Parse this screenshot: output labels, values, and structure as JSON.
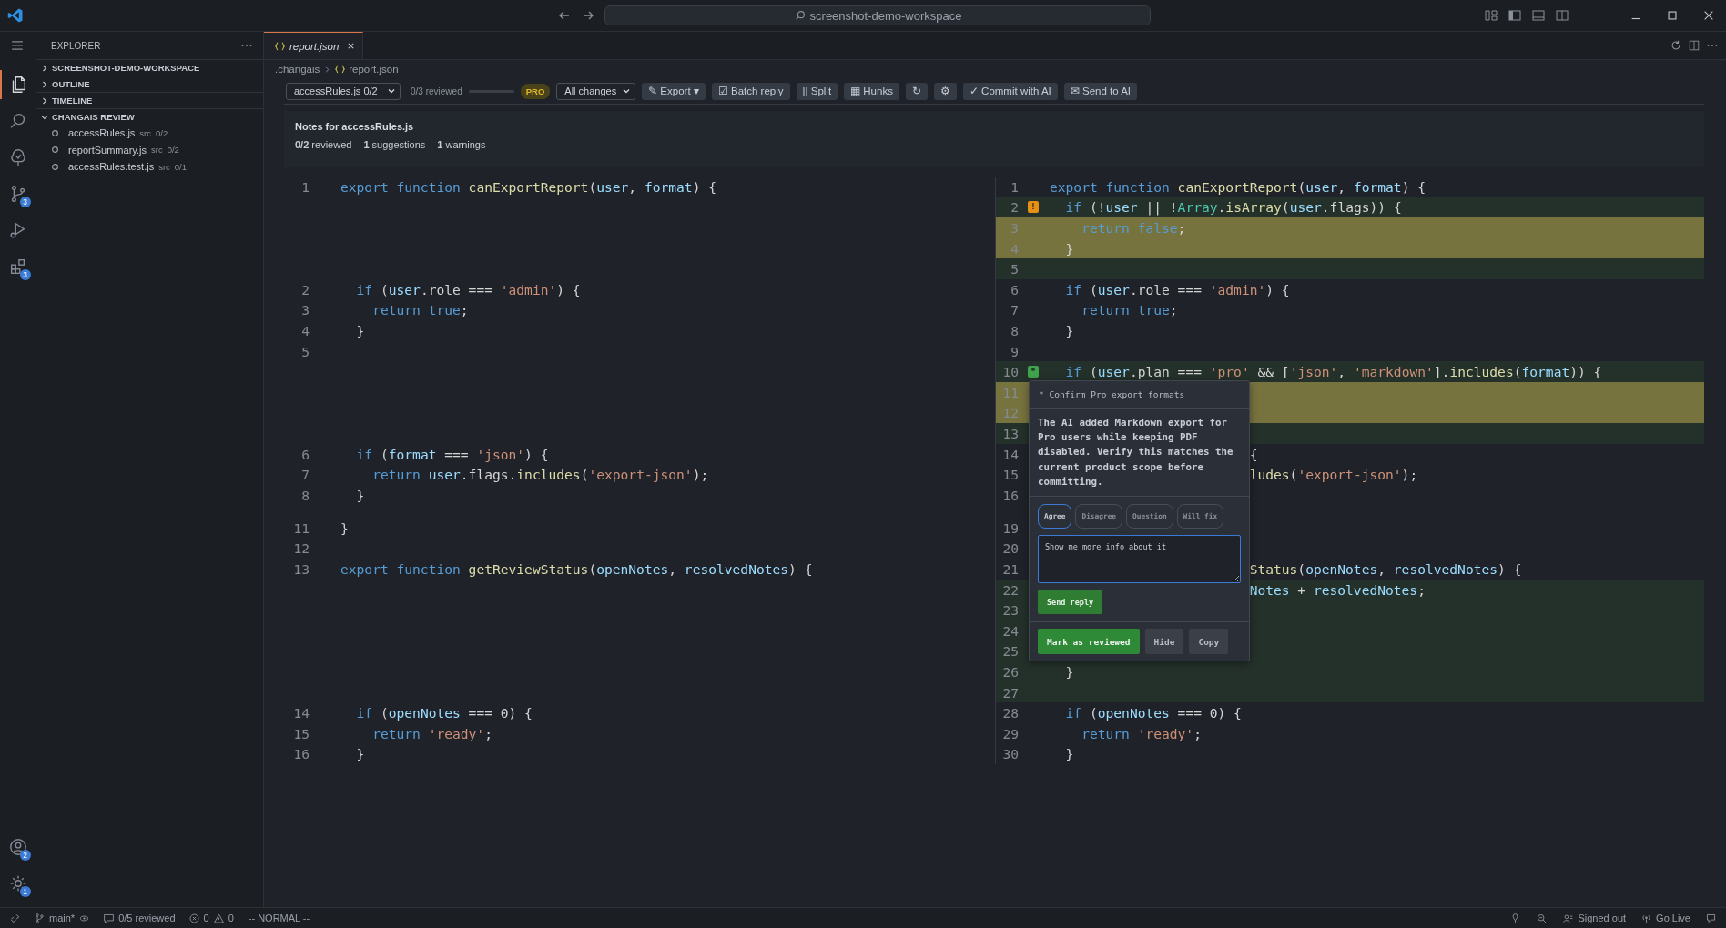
{
  "title_bar": {
    "search": "screenshot-demo-workspace"
  },
  "activity_bar": {
    "top": [
      {
        "kind": "files",
        "selected": true
      },
      {
        "kind": "search",
        "selected": false
      },
      {
        "kind": "tree",
        "selected": false
      },
      {
        "kind": "source-control",
        "selected": false,
        "badge": "3"
      },
      {
        "kind": "run",
        "selected": false
      },
      {
        "kind": "extensions",
        "selected": false,
        "badge": "3"
      }
    ],
    "bottom": [
      {
        "kind": "account",
        "badge": "2"
      },
      {
        "kind": "gear",
        "badge": "1"
      }
    ]
  },
  "sidebar": {
    "title": "EXPLORER",
    "sections": [
      {
        "label": "SCREENSHOT-DEMO-WORKSPACE",
        "expanded": false
      },
      {
        "label": "OUTLINE",
        "expanded": false
      },
      {
        "label": "TIMELINE",
        "expanded": false
      },
      {
        "label": "CHANGAIS REVIEW",
        "expanded": true,
        "items": [
          {
            "name": "accessRules.js",
            "folder": "src",
            "progress": "0/2"
          },
          {
            "name": "reportSummary.js",
            "folder": "src",
            "progress": "0/2"
          },
          {
            "name": "accessRules.test.js",
            "folder": "src",
            "progress": "0/1"
          }
        ]
      }
    ]
  },
  "tabs": [
    {
      "label": "report.json",
      "selected": true
    }
  ],
  "breadcrumb": [
    {
      "label": ".changais",
      "kind": "folder"
    },
    {
      "label": "report.json",
      "kind": "json"
    }
  ],
  "toolbar": {
    "file_select": "accessRules.js 0/2",
    "reviewed": "0/3 reviewed",
    "progress": {
      "level": 0
    },
    "badge": "PRO",
    "filter_select": "All changes",
    "buttons": [
      "✎ Export ▾",
      "☑ Batch reply",
      "|| Split",
      "▦ Hunks",
      "↻",
      "⚙",
      "✓ Commit with AI",
      "✉ Send to AI"
    ]
  },
  "notes": {
    "title": "Notes for accessRules.js",
    "stats": [
      "**0/2** reviewed",
      "**1** suggestions",
      "**1** warnings"
    ]
  },
  "diff": {
    "left": [
      {
        "kind": "line",
        "number": "1",
        "tokens": [
          {
            "kind": "keyword",
            "text": "export "
          },
          {
            "kind": "keyword",
            "text": "function "
          },
          {
            "kind": "function",
            "text": "canExportReport"
          },
          {
            "kind": "plain",
            "text": "("
          },
          {
            "kind": "variable",
            "text": "user"
          },
          {
            "kind": "plain",
            "text": ", "
          },
          {
            "kind": "variable",
            "text": "format"
          },
          {
            "kind": "plain",
            "text": ") {"
          }
        ]
      },
      {
        "kind": "filler"
      },
      {
        "kind": "filler"
      },
      {
        "kind": "filler"
      },
      {
        "kind": "filler"
      },
      {
        "kind": "line",
        "number": "2",
        "tokens": [
          {
            "kind": "keyword",
            "text": "  if "
          },
          {
            "kind": "plain",
            "text": "("
          },
          {
            "kind": "variable",
            "text": "user"
          },
          {
            "kind": "plain",
            "text": ".role === "
          },
          {
            "kind": "string",
            "text": "'admin'"
          },
          {
            "kind": "plain",
            "text": ") {"
          }
        ]
      },
      {
        "kind": "line",
        "number": "3",
        "tokens": [
          {
            "kind": "keyword",
            "text": "    return "
          },
          {
            "kind": "keyword",
            "text": "true"
          },
          {
            "kind": "plain",
            "text": ";"
          }
        ]
      },
      {
        "kind": "line",
        "number": "4",
        "tokens": [
          {
            "kind": "plain",
            "text": "  }"
          }
        ]
      },
      {
        "kind": "line",
        "number": "5"
      },
      {
        "kind": "filler"
      },
      {
        "kind": "filler"
      },
      {
        "kind": "filler"
      },
      {
        "kind": "filler"
      },
      {
        "kind": "line",
        "number": "6",
        "tokens": [
          {
            "kind": "keyword",
            "text": "  if "
          },
          {
            "kind": "plain",
            "text": "("
          },
          {
            "kind": "variable",
            "text": "format"
          },
          {
            "kind": "plain",
            "text": " === "
          },
          {
            "kind": "string",
            "text": "'json'"
          },
          {
            "kind": "plain",
            "text": ") {"
          }
        ]
      },
      {
        "kind": "line",
        "number": "7",
        "tokens": [
          {
            "kind": "keyword",
            "text": "    return "
          },
          {
            "kind": "variable",
            "text": "user"
          },
          {
            "kind": "plain",
            "text": ".flags."
          },
          {
            "kind": "function",
            "text": "includes"
          },
          {
            "kind": "plain",
            "text": "("
          },
          {
            "kind": "string",
            "text": "'export-json'"
          },
          {
            "kind": "plain",
            "text": ");"
          }
        ]
      },
      {
        "kind": "line",
        "number": "8",
        "tokens": [
          {
            "kind": "plain",
            "text": "  }"
          }
        ]
      },
      {
        "kind": "fold"
      },
      {
        "kind": "line",
        "number": "11",
        "tokens": [
          {
            "kind": "plain",
            "text": "}"
          }
        ]
      },
      {
        "kind": "line",
        "number": "12"
      },
      {
        "kind": "line",
        "number": "13",
        "tokens": [
          {
            "kind": "keyword",
            "text": "export "
          },
          {
            "kind": "keyword",
            "text": "function "
          },
          {
            "kind": "function",
            "text": "getReviewStatus"
          },
          {
            "kind": "plain",
            "text": "("
          },
          {
            "kind": "variable",
            "text": "openNotes"
          },
          {
            "kind": "plain",
            "text": ", "
          },
          {
            "kind": "variable",
            "text": "resolvedNotes"
          },
          {
            "kind": "plain",
            "text": ") {"
          }
        ]
      },
      {
        "kind": "filler"
      },
      {
        "kind": "filler"
      },
      {
        "kind": "filler"
      },
      {
        "kind": "filler"
      },
      {
        "kind": "filler"
      },
      {
        "kind": "filler"
      },
      {
        "kind": "line",
        "number": "14",
        "tokens": [
          {
            "kind": "keyword",
            "text": "  if "
          },
          {
            "kind": "plain",
            "text": "("
          },
          {
            "kind": "variable",
            "text": "openNotes"
          },
          {
            "kind": "plain",
            "text": " === 0) {"
          }
        ]
      },
      {
        "kind": "line",
        "number": "15",
        "tokens": [
          {
            "kind": "keyword",
            "text": "    return "
          },
          {
            "kind": "string",
            "text": "'ready'"
          },
          {
            "kind": "plain",
            "text": ";"
          }
        ]
      },
      {
        "kind": "line",
        "number": "16",
        "tokens": [
          {
            "kind": "plain",
            "text": "  }"
          }
        ]
      }
    ],
    "right": [
      {
        "kind": "line",
        "number": "1",
        "tokens": [
          {
            "kind": "keyword",
            "text": "export "
          },
          {
            "kind": "keyword",
            "text": "function "
          },
          {
            "kind": "function",
            "text": "canExportReport"
          },
          {
            "kind": "plain",
            "text": "("
          },
          {
            "kind": "variable",
            "text": "user"
          },
          {
            "kind": "plain",
            "text": ", "
          },
          {
            "kind": "variable",
            "text": "format"
          },
          {
            "kind": "plain",
            "text": ") {"
          }
        ]
      },
      {
        "kind": "added",
        "number": "2",
        "marker": {
          "kind": "warning",
          "symbol": "!"
        },
        "tokens": [
          {
            "kind": "keyword",
            "text": "  if "
          },
          {
            "kind": "plain",
            "text": "(!"
          },
          {
            "kind": "variable",
            "text": "user"
          },
          {
            "kind": "plain",
            "text": " || !"
          },
          {
            "kind": "type",
            "text": "Array"
          },
          {
            "kind": "plain",
            "text": "."
          },
          {
            "kind": "function",
            "text": "isArray"
          },
          {
            "kind": "plain",
            "text": "("
          },
          {
            "kind": "variable",
            "text": "user"
          },
          {
            "kind": "plain",
            "text": ".flags)) {"
          }
        ]
      },
      {
        "kind": "highlighted",
        "number": "3",
        "tokens": [
          {
            "kind": "keyword",
            "text": "    return "
          },
          {
            "kind": "keyword",
            "text": "false"
          },
          {
            "kind": "plain",
            "text": ";"
          }
        ]
      },
      {
        "kind": "highlighted",
        "number": "4",
        "tokens": [
          {
            "kind": "plain",
            "text": "  }"
          }
        ]
      },
      {
        "kind": "added",
        "number": "5"
      },
      {
        "kind": "line",
        "number": "6",
        "tokens": [
          {
            "kind": "keyword",
            "text": "  if "
          },
          {
            "kind": "plain",
            "text": "("
          },
          {
            "kind": "variable",
            "text": "user"
          },
          {
            "kind": "plain",
            "text": ".role === "
          },
          {
            "kind": "string",
            "text": "'admin'"
          },
          {
            "kind": "plain",
            "text": ") {"
          }
        ]
      },
      {
        "kind": "line",
        "number": "7",
        "tokens": [
          {
            "kind": "keyword",
            "text": "    return "
          },
          {
            "kind": "keyword",
            "text": "true"
          },
          {
            "kind": "plain",
            "text": ";"
          }
        ]
      },
      {
        "kind": "line",
        "number": "8",
        "tokens": [
          {
            "kind": "plain",
            "text": "  }"
          }
        ]
      },
      {
        "kind": "line",
        "number": "9"
      },
      {
        "kind": "added",
        "number": "10",
        "marker": {
          "kind": "ok",
          "symbol": "*"
        },
        "tokens": [
          {
            "kind": "keyword",
            "text": "  if "
          },
          {
            "kind": "plain",
            "text": "("
          },
          {
            "kind": "variable",
            "text": "user"
          },
          {
            "kind": "plain",
            "text": ".plan === "
          },
          {
            "kind": "string",
            "text": "'pro'"
          },
          {
            "kind": "plain",
            "text": " && ["
          },
          {
            "kind": "string",
            "text": "'json'"
          },
          {
            "kind": "plain",
            "text": ", "
          },
          {
            "kind": "string",
            "text": "'markdown'"
          },
          {
            "kind": "plain",
            "text": "]."
          },
          {
            "kind": "function",
            "text": "includes"
          },
          {
            "kind": "plain",
            "text": "("
          },
          {
            "kind": "variable",
            "text": "format"
          },
          {
            "kind": "plain",
            "text": ")) {"
          }
        ]
      },
      {
        "kind": "highlighted",
        "number": "11"
      },
      {
        "kind": "highlighted",
        "number": "12"
      },
      {
        "kind": "added",
        "number": "13"
      },
      {
        "kind": "covered",
        "number": "14",
        "tokens": [
          {
            "kind": "plain",
            "text": "{"
          }
        ]
      },
      {
        "kind": "covered",
        "number": "15",
        "tokens": [
          {
            "kind": "function",
            "text": "ludes"
          },
          {
            "kind": "plain",
            "text": "("
          },
          {
            "kind": "string",
            "text": "'export-json'"
          },
          {
            "kind": "plain",
            "text": ");"
          }
        ]
      },
      {
        "kind": "line",
        "number": "16"
      },
      {
        "kind": "fold"
      },
      {
        "kind": "line",
        "number": "19"
      },
      {
        "kind": "line",
        "number": "20"
      },
      {
        "kind": "covered",
        "number": "21",
        "tokens": [
          {
            "kind": "function",
            "text": "Status"
          },
          {
            "kind": "plain",
            "text": "("
          },
          {
            "kind": "variable",
            "text": "openNotes"
          },
          {
            "kind": "plain",
            "text": ", "
          },
          {
            "kind": "variable",
            "text": "resolvedNotes"
          },
          {
            "kind": "plain",
            "text": ") {"
          }
        ]
      },
      {
        "kind": "covered-added",
        "number": "22",
        "tokens": [
          {
            "kind": "variable",
            "text": "Notes"
          },
          {
            "kind": "plain",
            "text": " + "
          },
          {
            "kind": "variable",
            "text": "resolvedNotes"
          },
          {
            "kind": "plain",
            "text": ";"
          }
        ]
      },
      {
        "kind": "added",
        "number": "23"
      },
      {
        "kind": "added",
        "number": "24"
      },
      {
        "kind": "added",
        "number": "25"
      },
      {
        "kind": "added",
        "number": "26",
        "tokens": [
          {
            "kind": "plain",
            "text": "  }"
          }
        ]
      },
      {
        "kind": "added",
        "number": "27"
      },
      {
        "kind": "line",
        "number": "28",
        "tokens": [
          {
            "kind": "keyword",
            "text": "  if "
          },
          {
            "kind": "plain",
            "text": "("
          },
          {
            "kind": "variable",
            "text": "openNotes"
          },
          {
            "kind": "plain",
            "text": " === 0) {"
          }
        ]
      },
      {
        "kind": "line",
        "number": "29",
        "tokens": [
          {
            "kind": "keyword",
            "text": "    return "
          },
          {
            "kind": "string",
            "text": "'ready'"
          },
          {
            "kind": "plain",
            "text": ";"
          }
        ]
      },
      {
        "kind": "line",
        "number": "30",
        "tokens": [
          {
            "kind": "plain",
            "text": "  }"
          }
        ]
      }
    ]
  },
  "review_popup": {
    "title": "* Confirm Pro export formats",
    "body": "The AI added Markdown export for Pro users while keeping PDF disabled. Verify this matches the current product scope before committing.",
    "responses": [
      {
        "label": "Agree",
        "selected": true
      },
      {
        "label": "Disagree",
        "selected": false
      },
      {
        "label": "Question",
        "selected": false
      },
      {
        "label": "Will fix",
        "selected": false
      }
    ],
    "reply": "Show me more info about it",
    "send": "Send reply",
    "actions": [
      {
        "label": "Mark as reviewed",
        "kind": "primary"
      },
      {
        "label": "Hide",
        "kind": "secondary"
      },
      {
        "label": "Copy",
        "kind": "secondary"
      }
    ]
  },
  "status_bar": {
    "branch": "main*",
    "reviewed": "0/5 reviewed",
    "errors": "0",
    "warnings": "0",
    "mode": "-- NORMAL --",
    "account": "Signed out",
    "live": "Go Live"
  }
}
